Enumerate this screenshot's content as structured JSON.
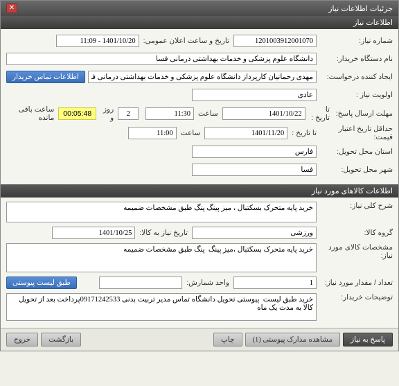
{
  "window": {
    "title": "جزئیات اطلاعات نیاز"
  },
  "section1": {
    "title": "اطلاعات نیاز"
  },
  "labels": {
    "need_no": "شماره نیاز:",
    "announce_dt": "تاریخ و ساعت اعلان عمومی:",
    "buyer_org": "نام دستگاه خریدار:",
    "requester": "ایجاد کننده درخواست:",
    "priority": "اولویت نیاز :",
    "deadline": "مهلت ارسال پاسخ:",
    "to_date": "تا تاریخ :",
    "time": "ساعت",
    "days_and": "روز و",
    "time_left": "ساعت باقی مانده",
    "price_validity": "حداقل تاریخ اعتبار قیمت:",
    "to_date2": "تا تاریخ :",
    "delivery_province": "استان محل تحویل:",
    "delivery_city": "شهر محل تحویل:"
  },
  "values": {
    "need_no": "1201003912001070",
    "announce_dt": "1401/10/20 - 11:09",
    "buyer_org": "دانشگاه علوم پزشکی و خدمات بهداشتی درمانی فسا",
    "requester": "مهدی رحمانیان کارپرداز دانشگاه علوم پزشکی و خدمات بهداشتی درمانی فسا",
    "priority": "عادی",
    "deadline_date": "1401/10/22",
    "deadline_time": "11:30",
    "days_left": "2",
    "countdown": "00:05:48",
    "validity_date": "1401/11/20",
    "validity_time": "11:00",
    "province": "فارس",
    "city": "فسا"
  },
  "buttons": {
    "buyer_contact": "اطلاعات تماس خریدار",
    "attach_list": "طبق لیست پیوستی",
    "respond": "پاسخ به نیاز",
    "view_attach": "مشاهده مدارک پیوستی (1)",
    "print": "چاپ",
    "back": "بازگشت",
    "exit": "خروج"
  },
  "section2": {
    "title": "اطلاعات کالاهای مورد نیاز"
  },
  "labels2": {
    "need_desc": "شرح کلی نیاز:",
    "goods_group": "گروه کالا:",
    "need_by_date": "تاریخ نیاز به کالا:",
    "goods_spec": "مشخصات کالای مورد نیاز:",
    "qty": "تعداد / مقدار مورد نیاز:",
    "unit": "واحد شمارش:",
    "buyer_notes": "توضیحات خریدار:"
  },
  "values2": {
    "need_desc": "خرید پایه متحرک بسکتبال ، میز پینگ پنگ طبق مشخصات ضمیمه",
    "goods_group": "ورزشی",
    "need_by_date": "1401/10/25",
    "goods_spec": "خرید پایه متحرک بسکتبال ،میز پینگ  پنگ طبق مشخصات ضمیمه",
    "qty": "1",
    "unit": "",
    "buyer_notes": "خرید طبق لیست  پیوستی تحویل دانشگاه تماس مدیر تربیت بدنی 09171242533پرداخت بعد از تحویل کالا به مدت یک ماه"
  }
}
